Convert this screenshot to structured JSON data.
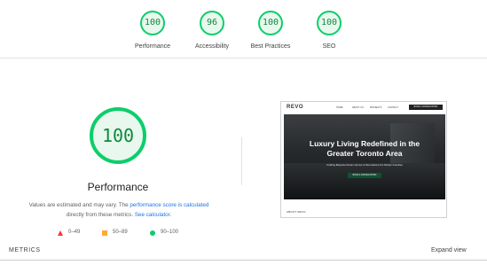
{
  "summary_gauges": [
    {
      "label": "Performance",
      "score": "100"
    },
    {
      "label": "Accessibility",
      "score": "96"
    },
    {
      "label": "Best Practices",
      "score": "100"
    },
    {
      "label": "SEO",
      "score": "100"
    }
  ],
  "main": {
    "score": "100",
    "title": "Performance",
    "desc_prefix": "Values are estimated and may vary. The ",
    "desc_link1": "performance score is calculated",
    "desc_mid": " directly from these metrics. ",
    "desc_link2": "See calculator",
    "desc_suffix": "."
  },
  "legend": {
    "fail": "0–49",
    "average": "50–89",
    "pass": "90–100"
  },
  "preview": {
    "logo": "REVO",
    "nav_links": [
      "HOME",
      "ABOUT US",
      "PROJECTS",
      "CONTACT"
    ],
    "nav_cta": "BOOK A CONSULTATION",
    "hero_title": "Luxury Living Redefined in the Greater Toronto Area",
    "hero_sub": "Crafting Bespoke Dream Homes & Renovations For Modern Families",
    "hero_btn": "BOOK A CONSULTATION",
    "below_text": "ABOUT REVO"
  },
  "metrics": {
    "label": "METRICS",
    "expand": "Expand view"
  },
  "colors": {
    "pass_green": "#0cce6b",
    "pass_text": "#0c8a3b",
    "pass_fill": "#e8f8ee",
    "fail_red": "#ff3333",
    "average_orange": "#ffaa33",
    "link_blue": "#1a73e8"
  }
}
